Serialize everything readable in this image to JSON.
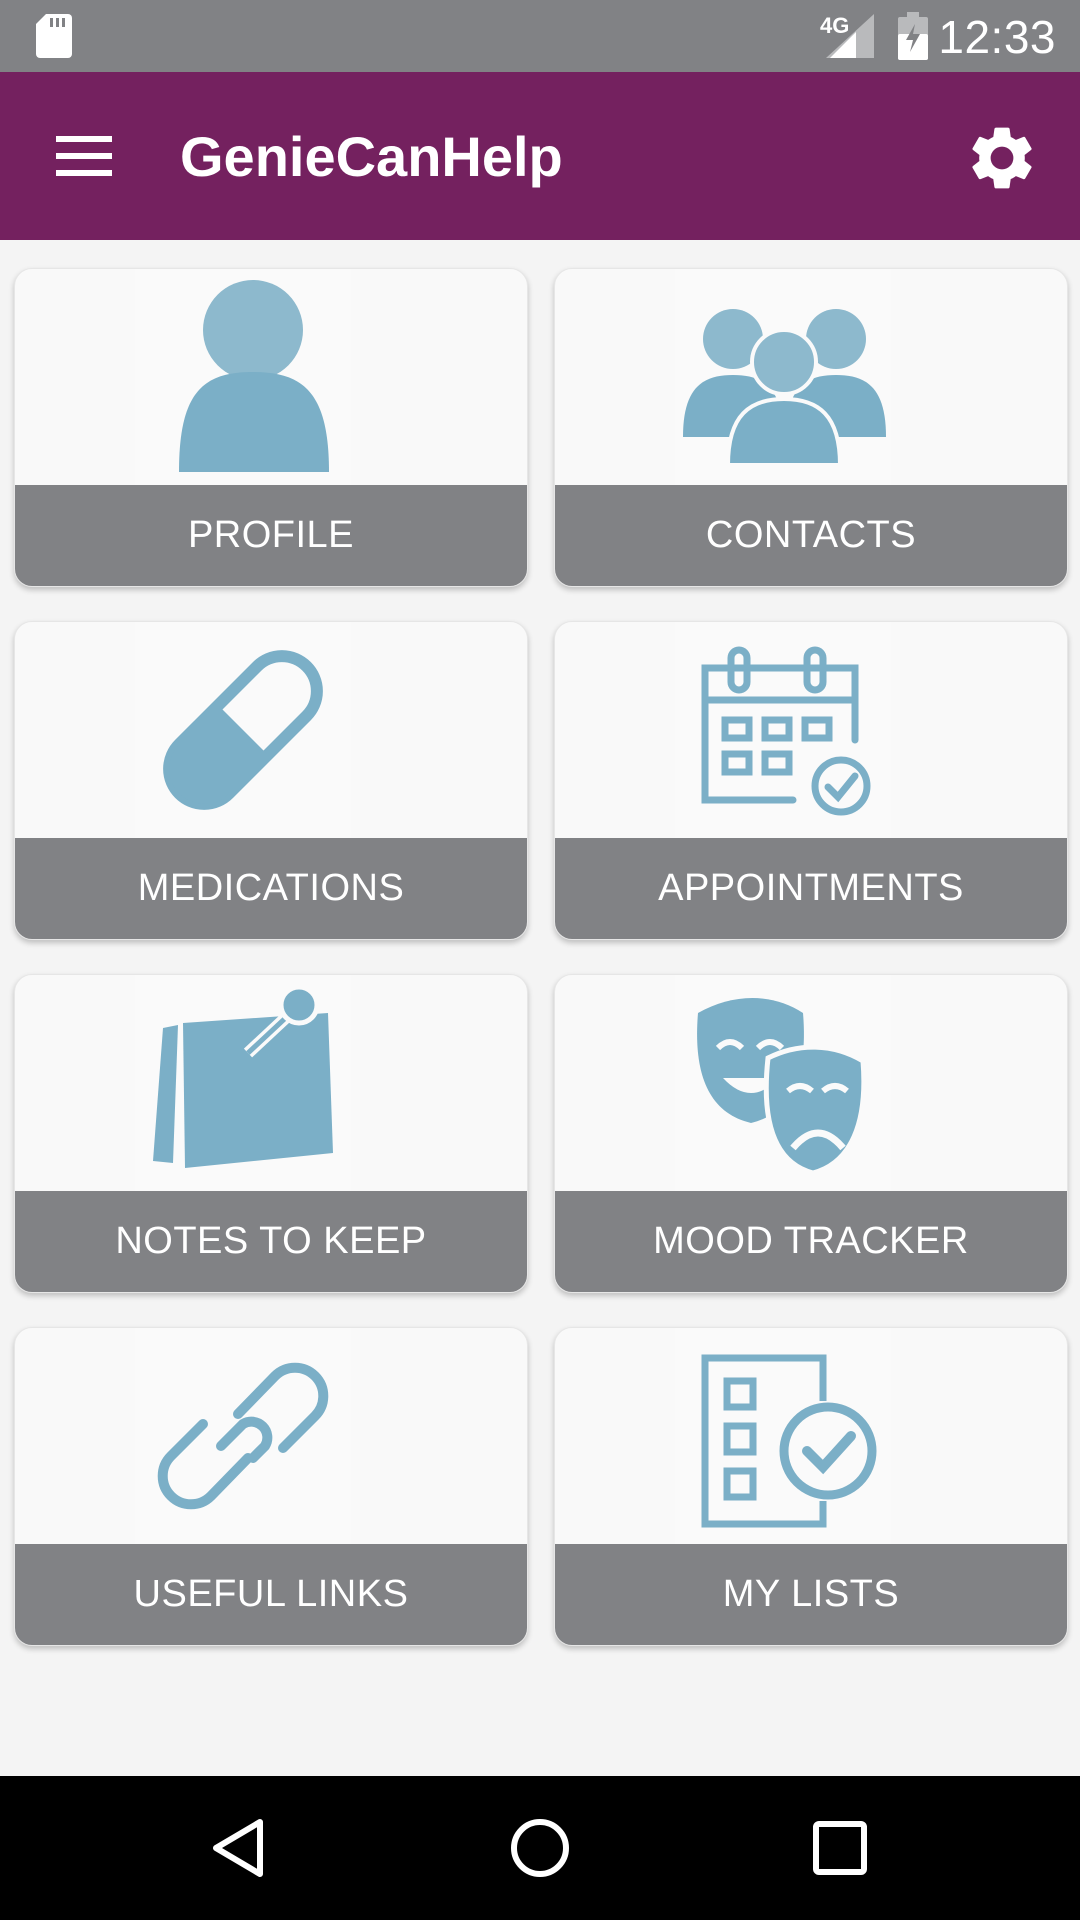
{
  "status_bar": {
    "network": "4G",
    "time": "12:33",
    "icons": [
      "sd-card-icon",
      "signal-icon",
      "battery-icon"
    ]
  },
  "app_bar": {
    "title": "GenieCanHelp",
    "menu_icon": "hamburger-menu-icon",
    "settings_icon": "gear-icon",
    "background": "#74215f"
  },
  "tiles": [
    {
      "label": "PROFILE",
      "icon": "person-icon"
    },
    {
      "label": "CONTACTS",
      "icon": "group-icon"
    },
    {
      "label": "MEDICATIONS",
      "icon": "pill-icon"
    },
    {
      "label": "APPOINTMENTS",
      "icon": "calendar-icon"
    },
    {
      "label": "NOTES TO KEEP",
      "icon": "pinned-note-icon"
    },
    {
      "label": "MOOD TRACKER",
      "icon": "theater-masks-icon"
    },
    {
      "label": "USEFUL LINKS",
      "icon": "chain-link-icon"
    },
    {
      "label": "MY LISTS",
      "icon": "checklist-icon"
    }
  ],
  "colors": {
    "accent": "#74215f",
    "tile_label_bg": "#818285",
    "icon_blue": "#7bafc7"
  },
  "nav_bar": {
    "icons": [
      "back-icon",
      "home-icon",
      "recents-icon"
    ]
  }
}
